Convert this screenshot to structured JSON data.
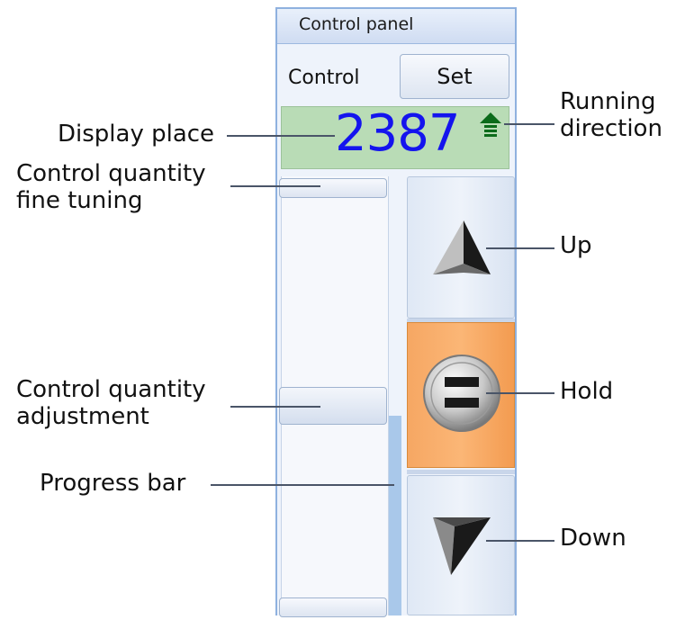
{
  "panel": {
    "title": "Control panel",
    "control_label": "Control",
    "set_label": "Set",
    "display_value": "2387"
  },
  "annotations": {
    "display_place": "Display place",
    "fine_tuning_line1": "Control quantity",
    "fine_tuning_line2": "fine tuning",
    "adjustment_line1": "Control quantity",
    "adjustment_line2": "adjustment",
    "progress_bar": "Progress bar",
    "running_line1": "Running",
    "running_line2": "direction",
    "up": "Up",
    "hold": "Hold",
    "down": "Down"
  },
  "colors": {
    "display_bg": "#b9dcb6",
    "display_text": "#1414ee",
    "hold_bg": "#fbb676",
    "direction_arrow": "#0b6b1a"
  },
  "icons": [
    "up-arrow-icon",
    "hold-icon",
    "down-arrow-icon",
    "running-direction-up-icon"
  ]
}
